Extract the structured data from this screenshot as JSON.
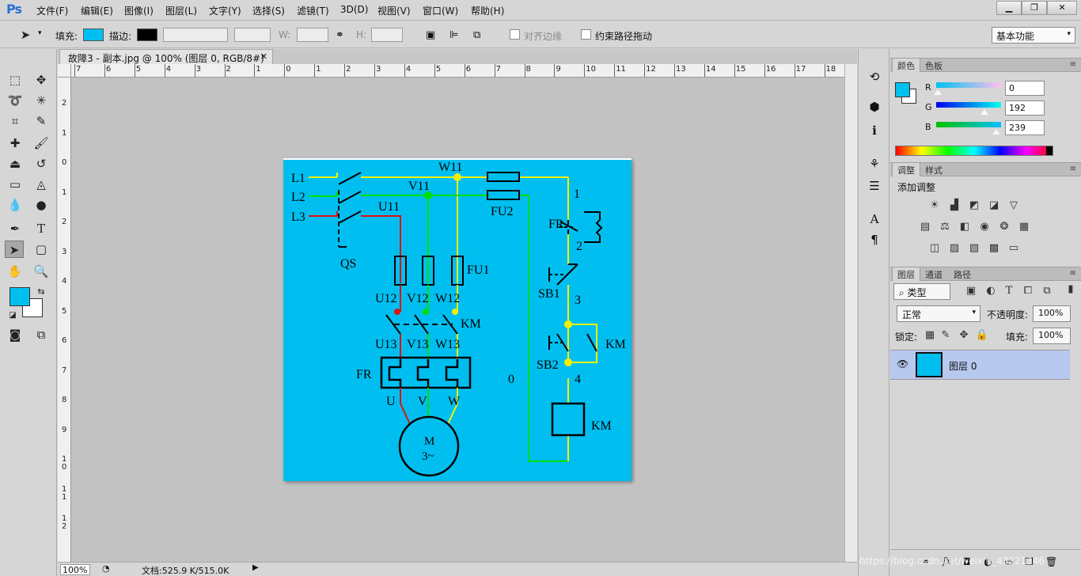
{
  "app": {
    "logo": "Ps"
  },
  "menu": [
    "文件(F)",
    "编辑(E)",
    "图像(I)",
    "图层(L)",
    "文字(Y)",
    "选择(S)",
    "滤镜(T)",
    "3D(D)",
    "视图(V)",
    "窗口(W)",
    "帮助(H)"
  ],
  "window_controls": {
    "minimize": "▁",
    "restore": "❐",
    "close": "✕"
  },
  "options": {
    "fill_label": "填充:",
    "fill_color": "#00bff0",
    "stroke_label": "描边:",
    "stroke_color": "#000000",
    "w_label": "W:",
    "h_label": "H:",
    "align_edges_label": "对齐边缘",
    "constrain_path_label": "约束路径拖动",
    "workspace": "基本功能"
  },
  "document": {
    "tab_title": "故障3 - 副本.jpg @ 100% (图层 0, RGB/8#) *",
    "ruler_h": [
      "7",
      "6",
      "5",
      "4",
      "3",
      "2",
      "1",
      "0",
      "1",
      "2",
      "3",
      "4",
      "5",
      "6",
      "7",
      "8",
      "9",
      "10",
      "11",
      "12",
      "13",
      "14",
      "15",
      "16",
      "17",
      "18"
    ],
    "ruler_v": [
      "2",
      "1",
      "0",
      "1",
      "2",
      "3",
      "4",
      "5",
      "6",
      "7",
      "8",
      "9",
      "10",
      "11",
      "12"
    ],
    "zoom": "100%",
    "doc_size": "文档:525.9 K/515.0K"
  },
  "schematic": {
    "labels": {
      "L1": "L1",
      "L2": "L2",
      "L3": "L3",
      "W11": "W11",
      "V11": "V11",
      "U11": "U11",
      "FU2": "FU2",
      "FU1": "FU1",
      "QS": "QS",
      "U12": "U12",
      "V12": "V12",
      "W12": "W12",
      "U13": "U13",
      "V13": "V13",
      "W13": "W13",
      "KM_contact": "KM",
      "FR_block": "FR",
      "U": "U",
      "V": "V",
      "W": "W",
      "motor_m": "M",
      "motor_3": "3~",
      "n1": "1",
      "n2": "2",
      "n3": "3",
      "n4": "4",
      "n0": "0",
      "FR_ctrl": "FR",
      "SB1": "SB1",
      "SB2": "SB2",
      "KM_hold": "KM",
      "KM_coil": "KM"
    },
    "colors": {
      "background": "#00bff0",
      "L1": "#f5f000",
      "L2": "#00e000",
      "L3": "#e01010",
      "black": "#000000"
    }
  },
  "color_panel": {
    "tabs": [
      "颜色",
      "色板"
    ],
    "fg": "#00c0ef",
    "bg": "#ffffff",
    "r_label": "R",
    "g_label": "G",
    "b_label": "B",
    "r": "0",
    "g": "192",
    "b": "239"
  },
  "adjust_panel": {
    "tabs": [
      "调整",
      "样式"
    ],
    "title": "添加调整"
  },
  "layers_panel": {
    "tabs": [
      "图层",
      "通道",
      "路径"
    ],
    "filter": "类型",
    "blend": "正常",
    "opacity_label": "不透明度:",
    "opacity": "100%",
    "lock_label": "锁定:",
    "fill_label": "填充:",
    "fill": "100%",
    "layer_name": "图层 0"
  },
  "watermark": "https://blog.csdn.net/weixin_43221346"
}
